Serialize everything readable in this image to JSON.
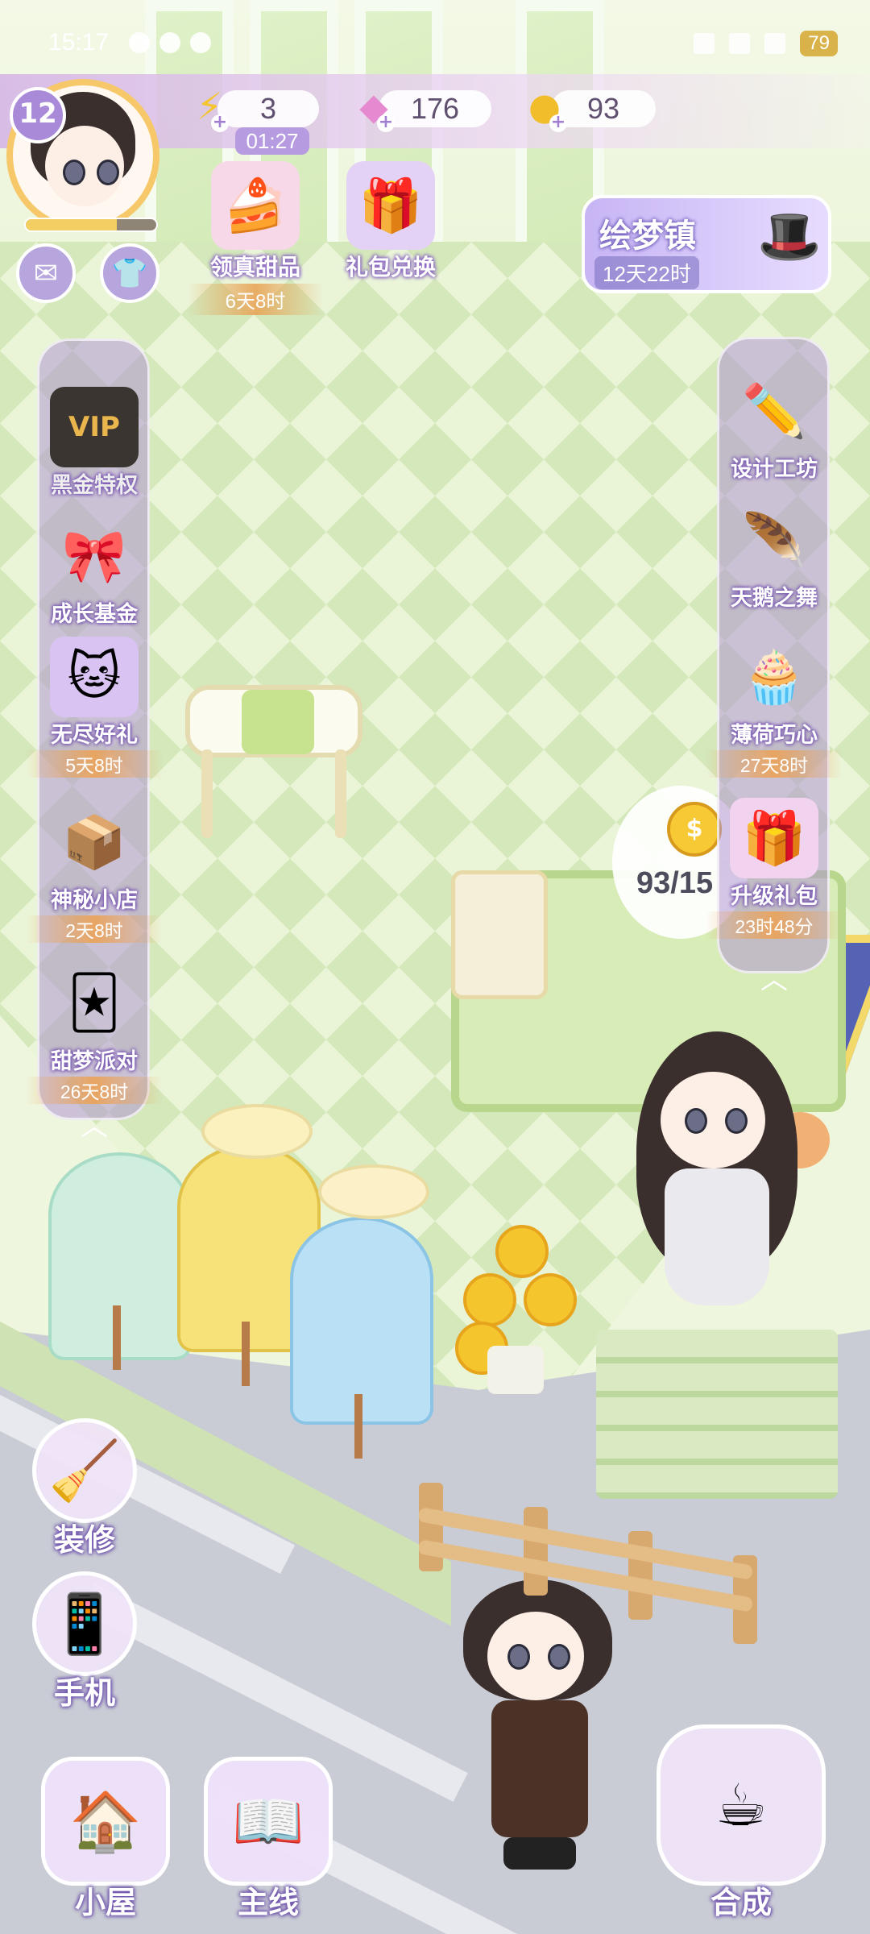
{
  "status_bar": {
    "time": "15:17",
    "battery": "79"
  },
  "player": {
    "level": "12",
    "xp_fraction": 0.7
  },
  "resources": {
    "energy": {
      "value": "3",
      "timer": "01:27",
      "icon": "lightning-icon"
    },
    "gems": {
      "value": "176",
      "icon": "diamond-icon"
    },
    "coins": {
      "value": "93",
      "icon": "coin-icon"
    }
  },
  "top_events": [
    {
      "id": "dessert",
      "label": "领真甜品",
      "timer": "6天8时",
      "icon": "dessert-icon"
    },
    {
      "id": "gift-exchange",
      "label": "礼包兑换",
      "icon": "gift-box-icon"
    }
  ],
  "dream_town": {
    "title": "绘梦镇",
    "timer": "12天22时"
  },
  "left_panel": [
    {
      "id": "black-gold",
      "label": "黑金特权",
      "icon": "vip-card-icon"
    },
    {
      "id": "growth-fund",
      "label": "成长基金",
      "icon": "gift-chest-icon"
    },
    {
      "id": "endless-gift",
      "label": "无尽好礼",
      "timer": "5天8时",
      "icon": "cat-gift-icon"
    },
    {
      "id": "mystery-shop",
      "label": "神秘小店",
      "timer": "2天8时",
      "icon": "shop-box-icon"
    },
    {
      "id": "sweet-party",
      "label": "甜梦派对",
      "timer": "26天8时",
      "icon": "cards-icon"
    }
  ],
  "right_panel": [
    {
      "id": "design-workshop",
      "label": "设计工坊",
      "icon": "ruler-pencil-icon"
    },
    {
      "id": "swan-dance",
      "label": "天鹅之舞",
      "icon": "feather-icon"
    },
    {
      "id": "mint-choco",
      "label": "薄荷巧心",
      "timer": "27天8时",
      "icon": "cake-icon"
    },
    {
      "id": "upgrade-pack",
      "label": "升级礼包",
      "timer": "23时48分",
      "icon": "upgrade-gift-icon"
    }
  ],
  "order_bubble": {
    "text": "93/15"
  },
  "side_buttons": [
    {
      "id": "decorate",
      "label": "装修",
      "icon": "brush-icon"
    },
    {
      "id": "phone",
      "label": "手机",
      "icon": "phone-icon"
    }
  ],
  "bottom_buttons": [
    {
      "id": "house",
      "label": "小屋",
      "icon": "house-icon"
    },
    {
      "id": "story",
      "label": "主线",
      "icon": "book-icon"
    },
    {
      "id": "merge",
      "label": "合成",
      "icon": "teacup-icon"
    }
  ],
  "colors": {
    "hud_purple": "#b79be0",
    "gold": "#f7c934",
    "label_outline": "#7b5bb3"
  }
}
